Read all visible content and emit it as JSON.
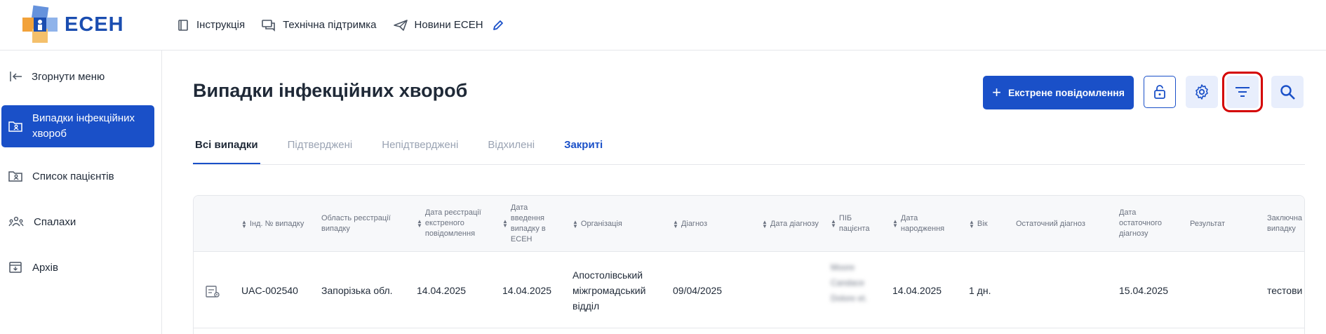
{
  "header": {
    "logo_text": "ЕСЕН",
    "nav": [
      {
        "label": "Інструкція",
        "icon": "book-icon"
      },
      {
        "label": "Технічна підтримка",
        "icon": "chat-icon"
      },
      {
        "label": "Новини ЕСЕН",
        "icon": "send-icon"
      }
    ]
  },
  "sidebar": {
    "collapse_label": "Згорнути меню",
    "items": [
      {
        "label": "Випадки інфекційних хвороб",
        "icon": "folder-user-icon",
        "active": true
      },
      {
        "label": "Список пацієнтів",
        "icon": "folder-user-icon"
      },
      {
        "label": "Спалахи",
        "icon": "group-icon"
      },
      {
        "label": "Архів",
        "icon": "archive-icon"
      }
    ]
  },
  "main": {
    "title": "Випадки інфекційних хвороб",
    "emergency_button": "Екстрене повідомлення",
    "tabs": [
      "Всі випадки",
      "Підтверджені",
      "Непідтверджені",
      "Відхилені",
      "Закриті"
    ]
  },
  "table": {
    "columns": [
      {
        "label": "Інд. № випадку",
        "sortable": true
      },
      {
        "label": "Область реєстрації випадку",
        "sortable": false
      },
      {
        "label": "Дата реєстрації екстреного повідомлення",
        "sortable": true
      },
      {
        "label": "Дата введення випадку в ЕСЕН",
        "sortable": true
      },
      {
        "label": "Організація",
        "sortable": true
      },
      {
        "label": "Діагноз",
        "sortable": true
      },
      {
        "label": "Дата діагнозу",
        "sortable": true
      },
      {
        "label": "ПІБ пацієнта",
        "sortable": true
      },
      {
        "label": "Дата народження",
        "sortable": true
      },
      {
        "label": "Вік",
        "sortable": true
      },
      {
        "label": "Остаточний діагноз",
        "sortable": false
      },
      {
        "label": "Дата остаточного діагнозу",
        "sortable": false
      },
      {
        "label": "Результат",
        "sortable": false
      },
      {
        "label": "Заключна випадку",
        "sortable": false
      }
    ],
    "rows": [
      {
        "case_id": "UAC-002540",
        "region": "Запорізька обл.",
        "emergency_date": "14.04.2025",
        "entry_date": "14.04.2025",
        "organization": "Апостолівський міжгромадський відділ",
        "diagnosis": "09/04/2025",
        "patient_name": "Moore Candace Dolore et.",
        "birth_date": "14.04.2025",
        "age": "1 дн.",
        "final_diagnosis_date": "15.04.2025",
        "final_note": "тестови"
      }
    ]
  },
  "colors": {
    "primary": "#1a50c8",
    "highlight": "#d40000"
  }
}
